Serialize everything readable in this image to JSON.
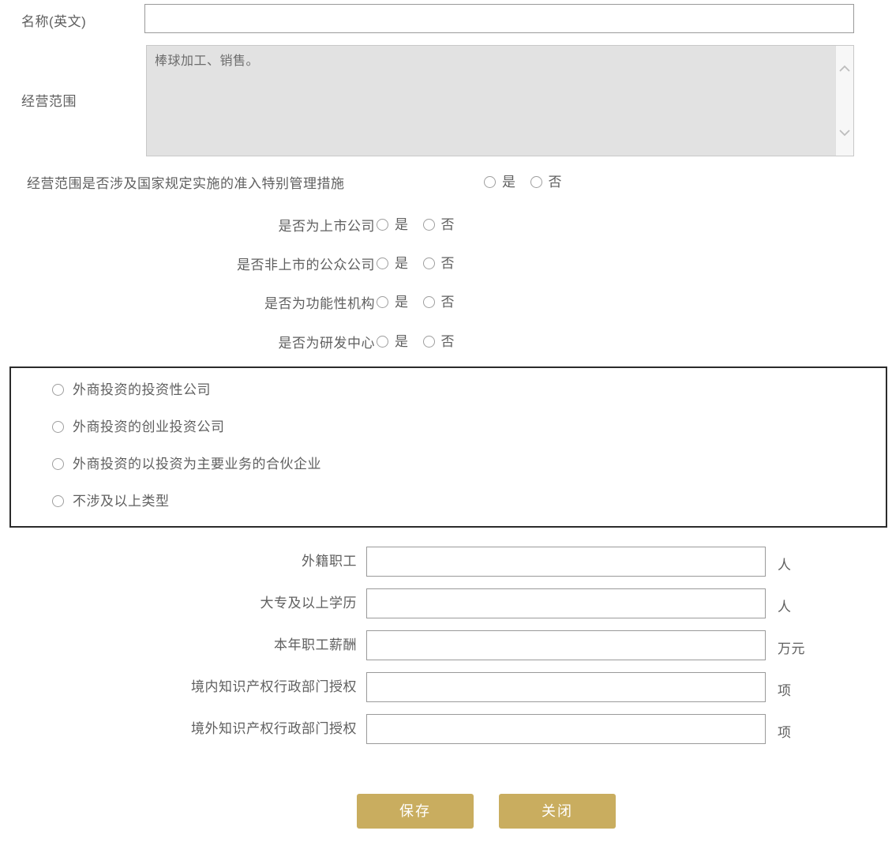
{
  "form": {
    "name_en": {
      "label": "名称(英文)",
      "value": "",
      "placeholder": ""
    },
    "business_scope": {
      "label": "经营范围",
      "value": "棒球加工、销售。",
      "scrollbar": {
        "up_icon": "chevron-up-icon",
        "down_icon": "chevron-down-icon"
      }
    },
    "special_access": {
      "label": "经营范围是否涉及国家规定实施的准入特别管理措施",
      "options": [
        "是",
        "否"
      ],
      "selected": ""
    },
    "yes_no_rows": [
      {
        "label": "是否为上市公司",
        "options": [
          "是",
          "否"
        ],
        "selected": ""
      },
      {
        "label": "是否非上市的公众公司",
        "options": [
          "是",
          "否"
        ],
        "selected": ""
      },
      {
        "label": "是否为功能性机构",
        "options": [
          "是",
          "否"
        ],
        "selected": ""
      },
      {
        "label": "是否为研发中心",
        "options": [
          "是",
          "否"
        ],
        "selected": ""
      }
    ],
    "investment_type": {
      "options": [
        "外商投资的投资性公司",
        "外商投资的创业投资公司",
        "外商投资的以投资为主要业务的合伙企业",
        "不涉及以上类型"
      ],
      "selected": ""
    },
    "numeric_rows": [
      {
        "label": "外籍职工",
        "value": "",
        "unit": "人"
      },
      {
        "label": "大专及以上学历",
        "value": "",
        "unit": "人"
      },
      {
        "label": "本年职工薪酬",
        "value": "",
        "unit": "万元"
      },
      {
        "label": "境内知识产权行政部门授权",
        "value": "",
        "unit": "项"
      },
      {
        "label": "境外知识产权行政部门授权",
        "value": "",
        "unit": "项"
      }
    ]
  },
  "actions": {
    "save_label": "保存",
    "close_label": "关闭",
    "button_color": "#c9ad5f"
  },
  "colors": {
    "accent": "#c9ad5f",
    "label_text": "#5f5f5f",
    "input_border": "#9a9a9a",
    "readonly_bg": "#e2e2e2",
    "box_border": "#2b2b2b"
  }
}
